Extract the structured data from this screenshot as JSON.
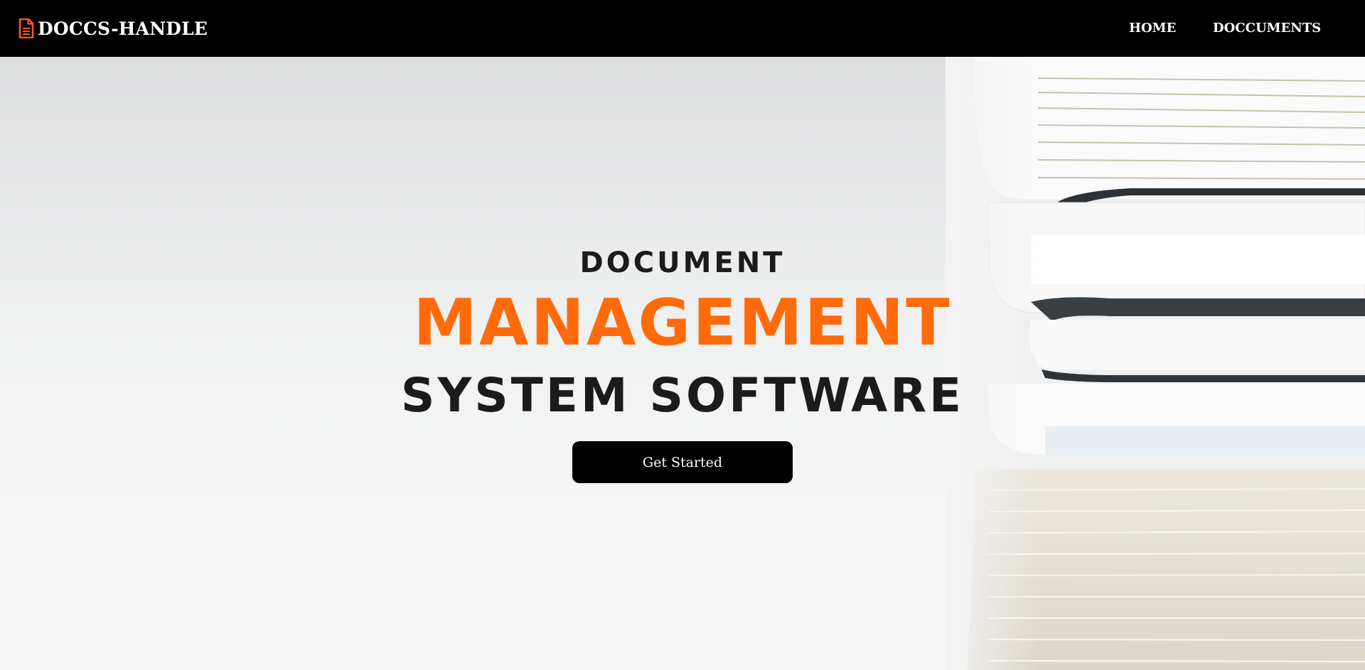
{
  "nav": {
    "brand": "DOCCS-HANDLE",
    "brand_icon": "document-icon",
    "links": [
      {
        "label": "HOME"
      },
      {
        "label": "DOCCUMENTS"
      }
    ]
  },
  "hero": {
    "line1": "DOCUMENT",
    "line2": "MANAGEMENT",
    "line3": "SYSTEM SOFTWARE",
    "cta_label": "Get Started",
    "image": "stacked-binders-photo"
  },
  "colors": {
    "accent": "#ff6b0a",
    "navbar": "#000000",
    "text_dark": "#1b1b1b",
    "button": "#000000"
  }
}
